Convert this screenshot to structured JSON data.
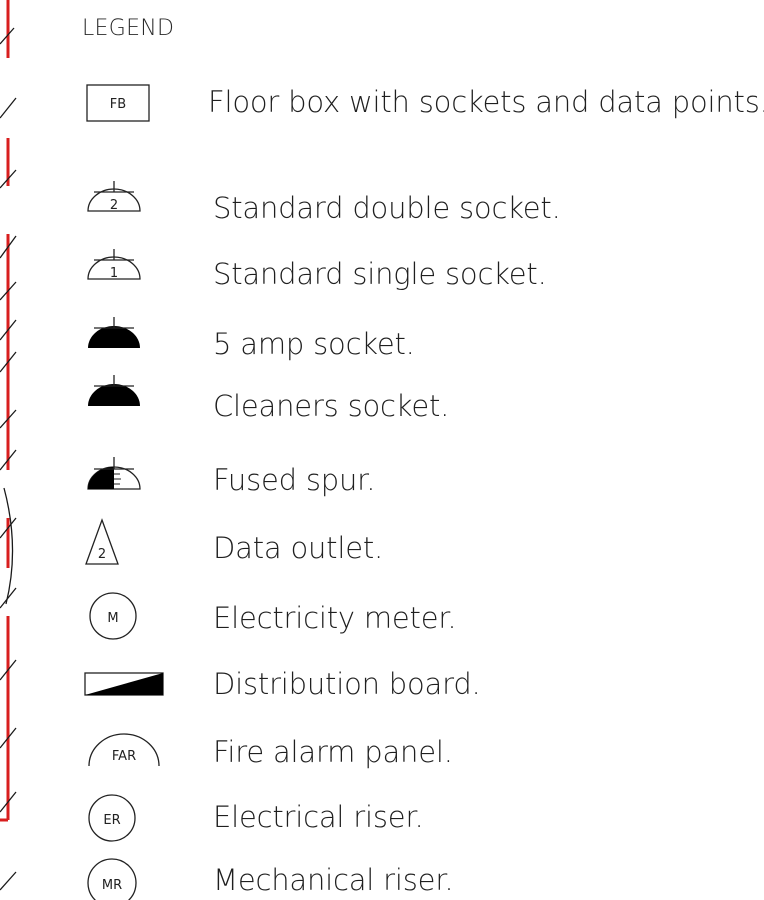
{
  "legend": {
    "title": "LEGEND",
    "items": [
      {
        "icon": "floor-box-icon",
        "symbol_text": "FB",
        "label": "Floor box with sockets and data points."
      },
      {
        "icon": "double-socket-icon",
        "symbol_text": "2",
        "label": "Standard double socket."
      },
      {
        "icon": "single-socket-icon",
        "symbol_text": "1",
        "label": "Standard single socket."
      },
      {
        "icon": "five-amp-socket-icon",
        "label": "5 amp socket."
      },
      {
        "icon": "cleaners-socket-icon",
        "label": "Cleaners socket."
      },
      {
        "icon": "fused-spur-icon",
        "label": "Fused spur."
      },
      {
        "icon": "data-outlet-icon",
        "symbol_text": "2",
        "label": "Data outlet."
      },
      {
        "icon": "electricity-meter-icon",
        "symbol_text": "M",
        "label": "Electricity meter."
      },
      {
        "icon": "distribution-board-icon",
        "label": "Distribution board."
      },
      {
        "icon": "fire-alarm-panel-icon",
        "symbol_text": "FAR",
        "label": "Fire alarm panel."
      },
      {
        "icon": "electrical-riser-icon",
        "symbol_text": "ER",
        "label": "Electrical riser."
      },
      {
        "icon": "mechanical-riser-icon",
        "symbol_text": "MR",
        "label": "Mechanical riser."
      }
    ]
  },
  "colors": {
    "wall_red": "#d81e1e",
    "line": "#1a1a1a"
  }
}
